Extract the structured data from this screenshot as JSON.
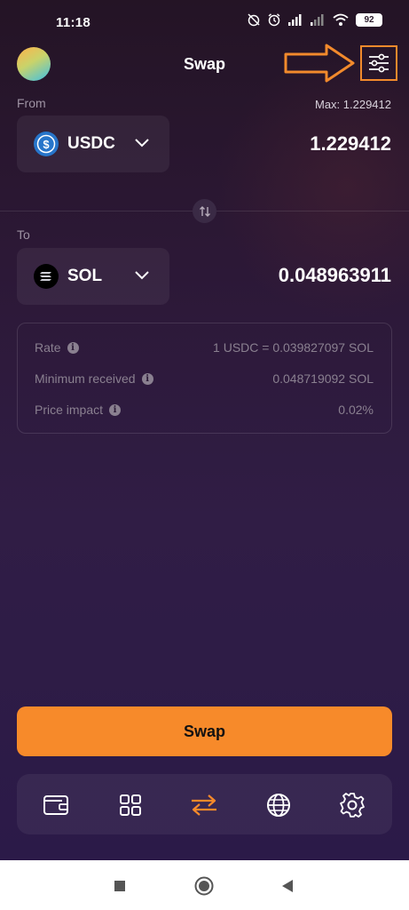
{
  "status_bar": {
    "time": "11:18",
    "battery": "92"
  },
  "header": {
    "title": "Swap"
  },
  "from": {
    "label": "From",
    "max_text": "Max: 1.229412",
    "token": "USDC",
    "amount": "1.229412"
  },
  "to": {
    "label": "To",
    "token": "SOL",
    "amount": "0.048963911"
  },
  "info": [
    {
      "label": "Rate",
      "value": "1 USDC = 0.039827097 SOL"
    },
    {
      "label": "Minimum received",
      "value": "0.048719092 SOL"
    },
    {
      "label": "Price impact",
      "value": "0.02%"
    }
  ],
  "swap_button": {
    "label": "Swap"
  },
  "bottom_nav": [
    "wallet-icon",
    "apps-grid-icon",
    "swap-arrows-icon",
    "globe-icon",
    "settings-gear-icon"
  ],
  "colors": {
    "accent": "#f78a2a",
    "annotation": "#f28a2c",
    "usdc": "#2775ca"
  }
}
